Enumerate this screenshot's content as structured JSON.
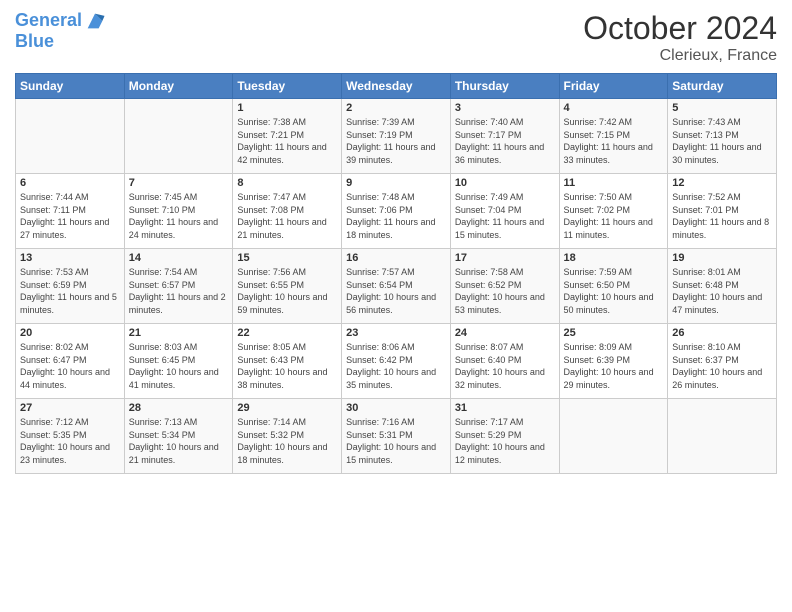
{
  "logo": {
    "line1": "General",
    "line2": "Blue"
  },
  "title": "October 2024",
  "location": "Clerieux, France",
  "days_header": [
    "Sunday",
    "Monday",
    "Tuesday",
    "Wednesday",
    "Thursday",
    "Friday",
    "Saturday"
  ],
  "weeks": [
    [
      {
        "day": "",
        "sunrise": "",
        "sunset": "",
        "daylight": ""
      },
      {
        "day": "",
        "sunrise": "",
        "sunset": "",
        "daylight": ""
      },
      {
        "day": "1",
        "sunrise": "Sunrise: 7:38 AM",
        "sunset": "Sunset: 7:21 PM",
        "daylight": "Daylight: 11 hours and 42 minutes."
      },
      {
        "day": "2",
        "sunrise": "Sunrise: 7:39 AM",
        "sunset": "Sunset: 7:19 PM",
        "daylight": "Daylight: 11 hours and 39 minutes."
      },
      {
        "day": "3",
        "sunrise": "Sunrise: 7:40 AM",
        "sunset": "Sunset: 7:17 PM",
        "daylight": "Daylight: 11 hours and 36 minutes."
      },
      {
        "day": "4",
        "sunrise": "Sunrise: 7:42 AM",
        "sunset": "Sunset: 7:15 PM",
        "daylight": "Daylight: 11 hours and 33 minutes."
      },
      {
        "day": "5",
        "sunrise": "Sunrise: 7:43 AM",
        "sunset": "Sunset: 7:13 PM",
        "daylight": "Daylight: 11 hours and 30 minutes."
      }
    ],
    [
      {
        "day": "6",
        "sunrise": "Sunrise: 7:44 AM",
        "sunset": "Sunset: 7:11 PM",
        "daylight": "Daylight: 11 hours and 27 minutes."
      },
      {
        "day": "7",
        "sunrise": "Sunrise: 7:45 AM",
        "sunset": "Sunset: 7:10 PM",
        "daylight": "Daylight: 11 hours and 24 minutes."
      },
      {
        "day": "8",
        "sunrise": "Sunrise: 7:47 AM",
        "sunset": "Sunset: 7:08 PM",
        "daylight": "Daylight: 11 hours and 21 minutes."
      },
      {
        "day": "9",
        "sunrise": "Sunrise: 7:48 AM",
        "sunset": "Sunset: 7:06 PM",
        "daylight": "Daylight: 11 hours and 18 minutes."
      },
      {
        "day": "10",
        "sunrise": "Sunrise: 7:49 AM",
        "sunset": "Sunset: 7:04 PM",
        "daylight": "Daylight: 11 hours and 15 minutes."
      },
      {
        "day": "11",
        "sunrise": "Sunrise: 7:50 AM",
        "sunset": "Sunset: 7:02 PM",
        "daylight": "Daylight: 11 hours and 11 minutes."
      },
      {
        "day": "12",
        "sunrise": "Sunrise: 7:52 AM",
        "sunset": "Sunset: 7:01 PM",
        "daylight": "Daylight: 11 hours and 8 minutes."
      }
    ],
    [
      {
        "day": "13",
        "sunrise": "Sunrise: 7:53 AM",
        "sunset": "Sunset: 6:59 PM",
        "daylight": "Daylight: 11 hours and 5 minutes."
      },
      {
        "day": "14",
        "sunrise": "Sunrise: 7:54 AM",
        "sunset": "Sunset: 6:57 PM",
        "daylight": "Daylight: 11 hours and 2 minutes."
      },
      {
        "day": "15",
        "sunrise": "Sunrise: 7:56 AM",
        "sunset": "Sunset: 6:55 PM",
        "daylight": "Daylight: 10 hours and 59 minutes."
      },
      {
        "day": "16",
        "sunrise": "Sunrise: 7:57 AM",
        "sunset": "Sunset: 6:54 PM",
        "daylight": "Daylight: 10 hours and 56 minutes."
      },
      {
        "day": "17",
        "sunrise": "Sunrise: 7:58 AM",
        "sunset": "Sunset: 6:52 PM",
        "daylight": "Daylight: 10 hours and 53 minutes."
      },
      {
        "day": "18",
        "sunrise": "Sunrise: 7:59 AM",
        "sunset": "Sunset: 6:50 PM",
        "daylight": "Daylight: 10 hours and 50 minutes."
      },
      {
        "day": "19",
        "sunrise": "Sunrise: 8:01 AM",
        "sunset": "Sunset: 6:48 PM",
        "daylight": "Daylight: 10 hours and 47 minutes."
      }
    ],
    [
      {
        "day": "20",
        "sunrise": "Sunrise: 8:02 AM",
        "sunset": "Sunset: 6:47 PM",
        "daylight": "Daylight: 10 hours and 44 minutes."
      },
      {
        "day": "21",
        "sunrise": "Sunrise: 8:03 AM",
        "sunset": "Sunset: 6:45 PM",
        "daylight": "Daylight: 10 hours and 41 minutes."
      },
      {
        "day": "22",
        "sunrise": "Sunrise: 8:05 AM",
        "sunset": "Sunset: 6:43 PM",
        "daylight": "Daylight: 10 hours and 38 minutes."
      },
      {
        "day": "23",
        "sunrise": "Sunrise: 8:06 AM",
        "sunset": "Sunset: 6:42 PM",
        "daylight": "Daylight: 10 hours and 35 minutes."
      },
      {
        "day": "24",
        "sunrise": "Sunrise: 8:07 AM",
        "sunset": "Sunset: 6:40 PM",
        "daylight": "Daylight: 10 hours and 32 minutes."
      },
      {
        "day": "25",
        "sunrise": "Sunrise: 8:09 AM",
        "sunset": "Sunset: 6:39 PM",
        "daylight": "Daylight: 10 hours and 29 minutes."
      },
      {
        "day": "26",
        "sunrise": "Sunrise: 8:10 AM",
        "sunset": "Sunset: 6:37 PM",
        "daylight": "Daylight: 10 hours and 26 minutes."
      }
    ],
    [
      {
        "day": "27",
        "sunrise": "Sunrise: 7:12 AM",
        "sunset": "Sunset: 5:35 PM",
        "daylight": "Daylight: 10 hours and 23 minutes."
      },
      {
        "day": "28",
        "sunrise": "Sunrise: 7:13 AM",
        "sunset": "Sunset: 5:34 PM",
        "daylight": "Daylight: 10 hours and 21 minutes."
      },
      {
        "day": "29",
        "sunrise": "Sunrise: 7:14 AM",
        "sunset": "Sunset: 5:32 PM",
        "daylight": "Daylight: 10 hours and 18 minutes."
      },
      {
        "day": "30",
        "sunrise": "Sunrise: 7:16 AM",
        "sunset": "Sunset: 5:31 PM",
        "daylight": "Daylight: 10 hours and 15 minutes."
      },
      {
        "day": "31",
        "sunrise": "Sunrise: 7:17 AM",
        "sunset": "Sunset: 5:29 PM",
        "daylight": "Daylight: 10 hours and 12 minutes."
      },
      {
        "day": "",
        "sunrise": "",
        "sunset": "",
        "daylight": ""
      },
      {
        "day": "",
        "sunrise": "",
        "sunset": "",
        "daylight": ""
      }
    ]
  ]
}
